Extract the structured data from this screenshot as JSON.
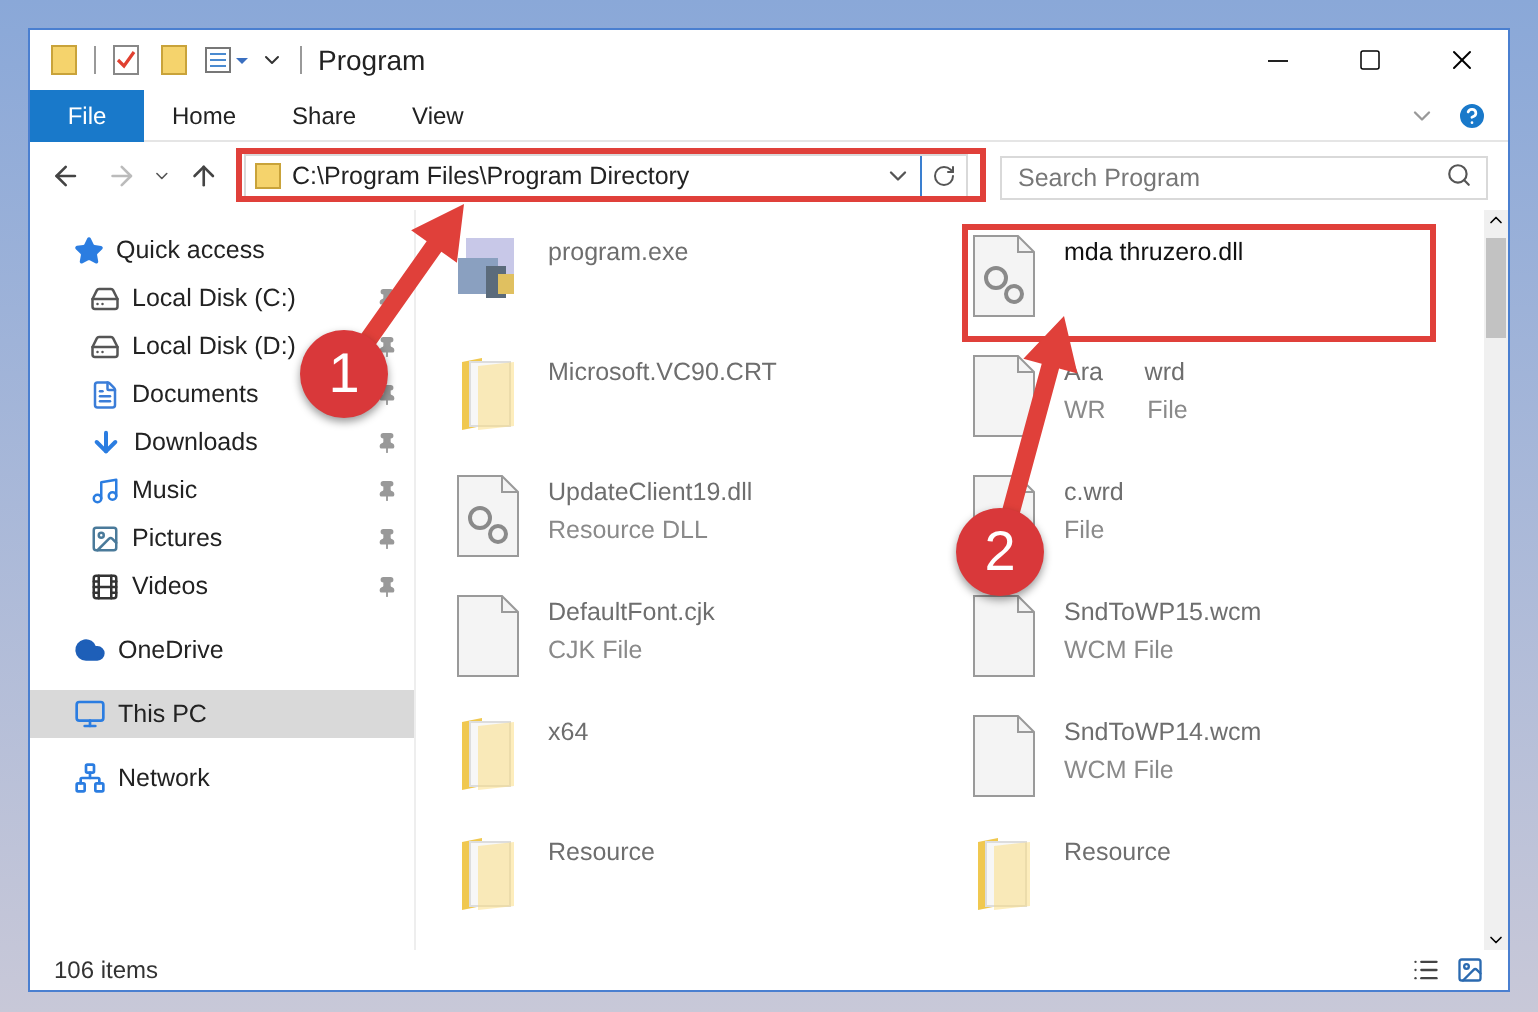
{
  "window": {
    "title": "Program"
  },
  "ribbon": {
    "tabs": [
      {
        "label": "File",
        "kind": "file"
      },
      {
        "label": "Home",
        "kind": "tab"
      },
      {
        "label": "Share",
        "kind": "tab"
      },
      {
        "label": "View",
        "kind": "tab"
      }
    ]
  },
  "address_bar": {
    "path": "C:\\Program Files\\Program Directory"
  },
  "search": {
    "placeholder": "Search Program"
  },
  "sidebar": {
    "items": [
      {
        "label": "Quick access",
        "selected": false,
        "children": [
          {
            "label": "Local Disk (C:)",
            "pinned": true
          },
          {
            "label": "Local Disk (D:)",
            "pinned": true
          },
          {
            "label": "Documents",
            "pinned": true
          },
          {
            "label": "Downloads",
            "pinned": true
          },
          {
            "label": "Music",
            "pinned": true
          },
          {
            "label": "Pictures",
            "pinned": true
          },
          {
            "label": "Videos",
            "pinned": true
          }
        ]
      },
      {
        "label": "OneDrive",
        "selected": false
      },
      {
        "label": "This PC",
        "selected": true
      },
      {
        "label": "Network",
        "selected": false
      }
    ]
  },
  "files": [
    {
      "name": "program.exe",
      "kind": "exe",
      "blurred": true
    },
    {
      "name": "mda thruzero.dll",
      "kind": "dll",
      "blurred": false
    },
    {
      "name": "Microsoft.VC90.CRT",
      "kind": "folder",
      "blurred": true
    },
    {
      "name": "Ara      wrd",
      "type": "WR      File",
      "kind": "file",
      "blurred": true
    },
    {
      "name": "UpdateClient19.dll",
      "type": "Resource DLL",
      "kind": "dll",
      "blurred": true
    },
    {
      "name": "c.wrd",
      "type": "File",
      "kind": "file",
      "blurred": true
    },
    {
      "name": "DefaultFont.cjk",
      "type": "CJK File",
      "kind": "file",
      "blurred": true
    },
    {
      "name": "SndToWP15.wcm",
      "type": "WCM File",
      "kind": "file",
      "blurred": true
    },
    {
      "name": "x64",
      "kind": "folder",
      "blurred": true
    },
    {
      "name": "SndToWP14.wcm",
      "type": "WCM File",
      "kind": "file",
      "blurred": true
    },
    {
      "name": "Resource",
      "kind": "folder",
      "blurred": true
    },
    {
      "name": "Resource",
      "kind": "folder",
      "blurred": true
    }
  ],
  "annotations": [
    {
      "label": "1"
    },
    {
      "label": "2"
    }
  ],
  "status_bar": {
    "item_count": "106 items"
  }
}
